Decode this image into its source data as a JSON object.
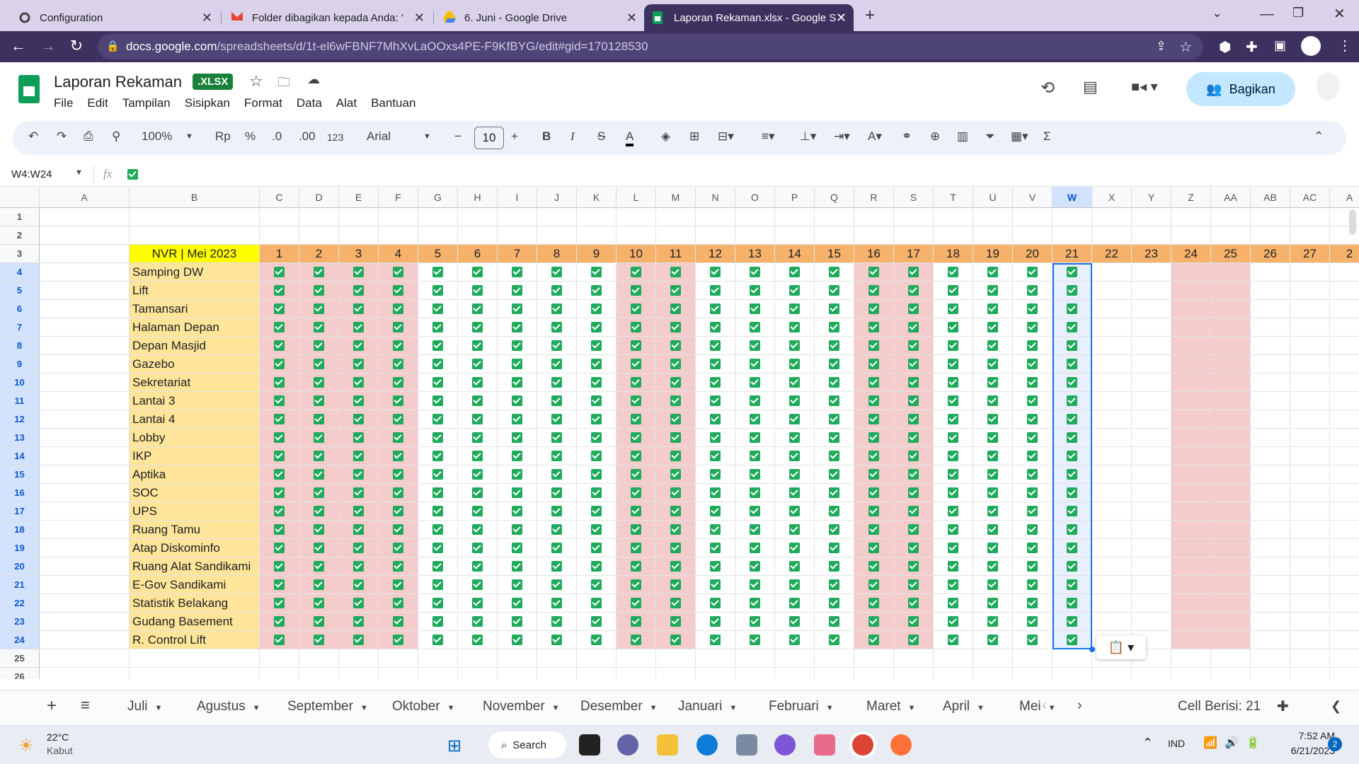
{
  "browser": {
    "tabs": [
      {
        "title": "Configuration",
        "icon": "gear-icon",
        "active": false
      },
      {
        "title": "Folder dibagikan kepada Anda: '",
        "icon": "gmail-icon",
        "active": false
      },
      {
        "title": "6. Juni - Google Drive",
        "icon": "drive-icon",
        "active": false
      },
      {
        "title": "Laporan Rekaman.xlsx - Google S",
        "icon": "sheets-icon",
        "active": true
      }
    ],
    "url_domain": "docs.google.com",
    "url_path": "/spreadsheets/d/1t-el6wFBNF7MhXvLaOOxs4PE-F9KfBYG/edit#gid=170128530"
  },
  "doc": {
    "title": "Laporan Rekaman",
    "badge": ".XLSX",
    "menus": [
      "File",
      "Edit",
      "Tampilan",
      "Sisipkan",
      "Format",
      "Data",
      "Alat",
      "Bantuan"
    ],
    "share_label": "Bagikan"
  },
  "toolbar": {
    "zoom": "100%",
    "currency": "Rp",
    "percent": "%",
    "dec_less": ".0",
    "dec_more": ".00",
    "number_format": "123",
    "font": "Arial",
    "font_size": "10"
  },
  "formula": {
    "name_box": "W4:W24",
    "fx": "fx"
  },
  "sheet": {
    "columns": [
      "A",
      "B",
      "C",
      "D",
      "E",
      "F",
      "G",
      "H",
      "I",
      "J",
      "K",
      "L",
      "M",
      "N",
      "O",
      "P",
      "Q",
      "R",
      "S",
      "T",
      "U",
      "V",
      "W",
      "X",
      "Y",
      "Z",
      "AA",
      "AB",
      "AC",
      "A"
    ],
    "row_numbers": [
      "1",
      "2",
      "3",
      "4",
      "5",
      "6",
      "7",
      "8",
      "9",
      "10",
      "11",
      "12",
      "13",
      "14",
      "15",
      "16",
      "17",
      "18",
      "19",
      "20",
      "21",
      "22",
      "23",
      "24",
      "25",
      "26"
    ],
    "header_label": "NVR | Mei 2023",
    "days": [
      "1",
      "2",
      "3",
      "4",
      "5",
      "6",
      "7",
      "8",
      "9",
      "10",
      "11",
      "12",
      "13",
      "14",
      "15",
      "16",
      "17",
      "18",
      "19",
      "20",
      "21",
      "22",
      "23",
      "24",
      "25",
      "26",
      "27",
      "2"
    ],
    "locations": [
      "Samping DW",
      "Lift",
      "Tamansari",
      "Halaman Depan",
      "Depan Masjid",
      "Gazebo",
      "Sekretariat",
      "Lantai 3",
      "Lantai 4",
      "Lobby",
      "IKP",
      "Aptika",
      "SOC",
      "UPS",
      "Ruang Tamu",
      "Atap Diskominfo",
      "Ruang Alat Sandikami",
      "E-Gov Sandikami",
      "Statistik Belakang",
      "Gudang Basement",
      "R. Control Lift"
    ],
    "checked_days": 21,
    "weekend_day_indexes": [
      0,
      1,
      2,
      3,
      9,
      10,
      15,
      16,
      23,
      24
    ],
    "colors": {
      "header_orange": "#f6b26b",
      "label_yellow": "#ffe599",
      "title_yellow": "#ffff00",
      "weekend_pink": "#f4cccc",
      "check_green": "#1faa5c",
      "selection_blue": "#1a73e8"
    }
  },
  "sheet_tabs": [
    "Juli",
    "Agustus",
    "September",
    "Oktober",
    "November",
    "Desember",
    "Januari",
    "Februari",
    "Maret",
    "April",
    "Mei"
  ],
  "status": "Cell Berisi: 21",
  "taskbar": {
    "weather_temp": "22°C",
    "weather_desc": "Kabut",
    "search_label": "Search",
    "lang": "IND",
    "time": "7:52 AM",
    "date": "6/21/2023",
    "notif_count": "2"
  }
}
